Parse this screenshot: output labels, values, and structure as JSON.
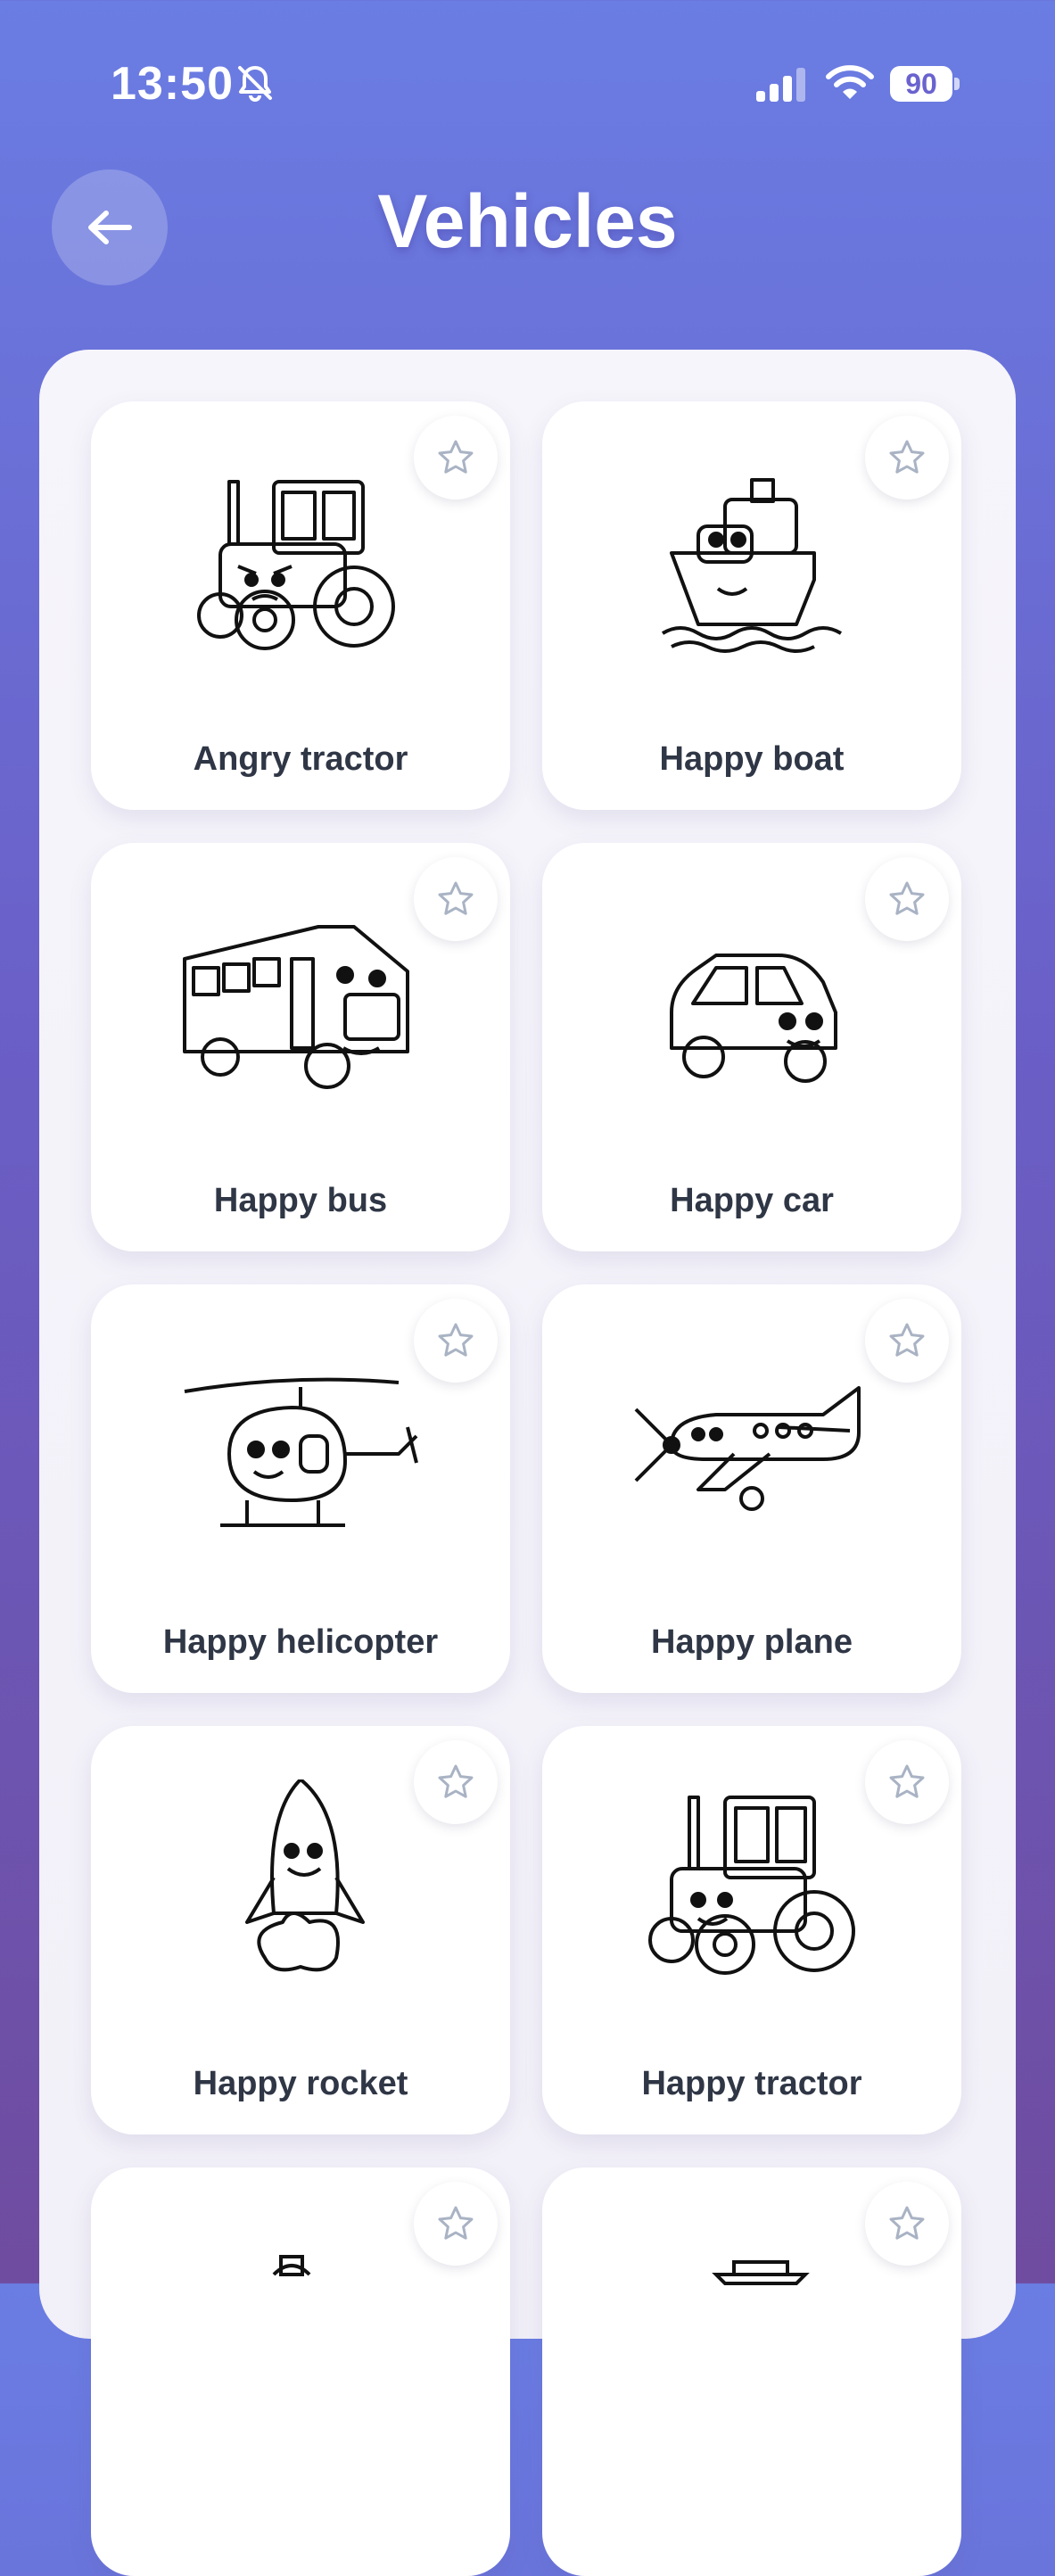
{
  "status": {
    "time": "13:50",
    "battery": "90",
    "icons": [
      "bell-slash-icon",
      "cellular-signal-icon",
      "wifi-icon",
      "battery-icon"
    ]
  },
  "header": {
    "title": "Vehicles",
    "back_icon": "arrow-left-icon"
  },
  "grid": {
    "items": [
      {
        "label": "Angry tractor",
        "favorite": false
      },
      {
        "label": "Happy boat",
        "favorite": false
      },
      {
        "label": "Happy bus",
        "favorite": false
      },
      {
        "label": "Happy car",
        "favorite": false
      },
      {
        "label": "Happy helicopter",
        "favorite": false
      },
      {
        "label": "Happy plane",
        "favorite": false
      },
      {
        "label": "Happy rocket",
        "favorite": false
      },
      {
        "label": "Happy tractor",
        "favorite": false
      },
      {
        "label": "",
        "favorite": false
      },
      {
        "label": "",
        "favorite": false
      }
    ]
  },
  "colors": {
    "accent": "#6a63cf",
    "text": "#2f3645",
    "star": "#a9b3c4"
  }
}
